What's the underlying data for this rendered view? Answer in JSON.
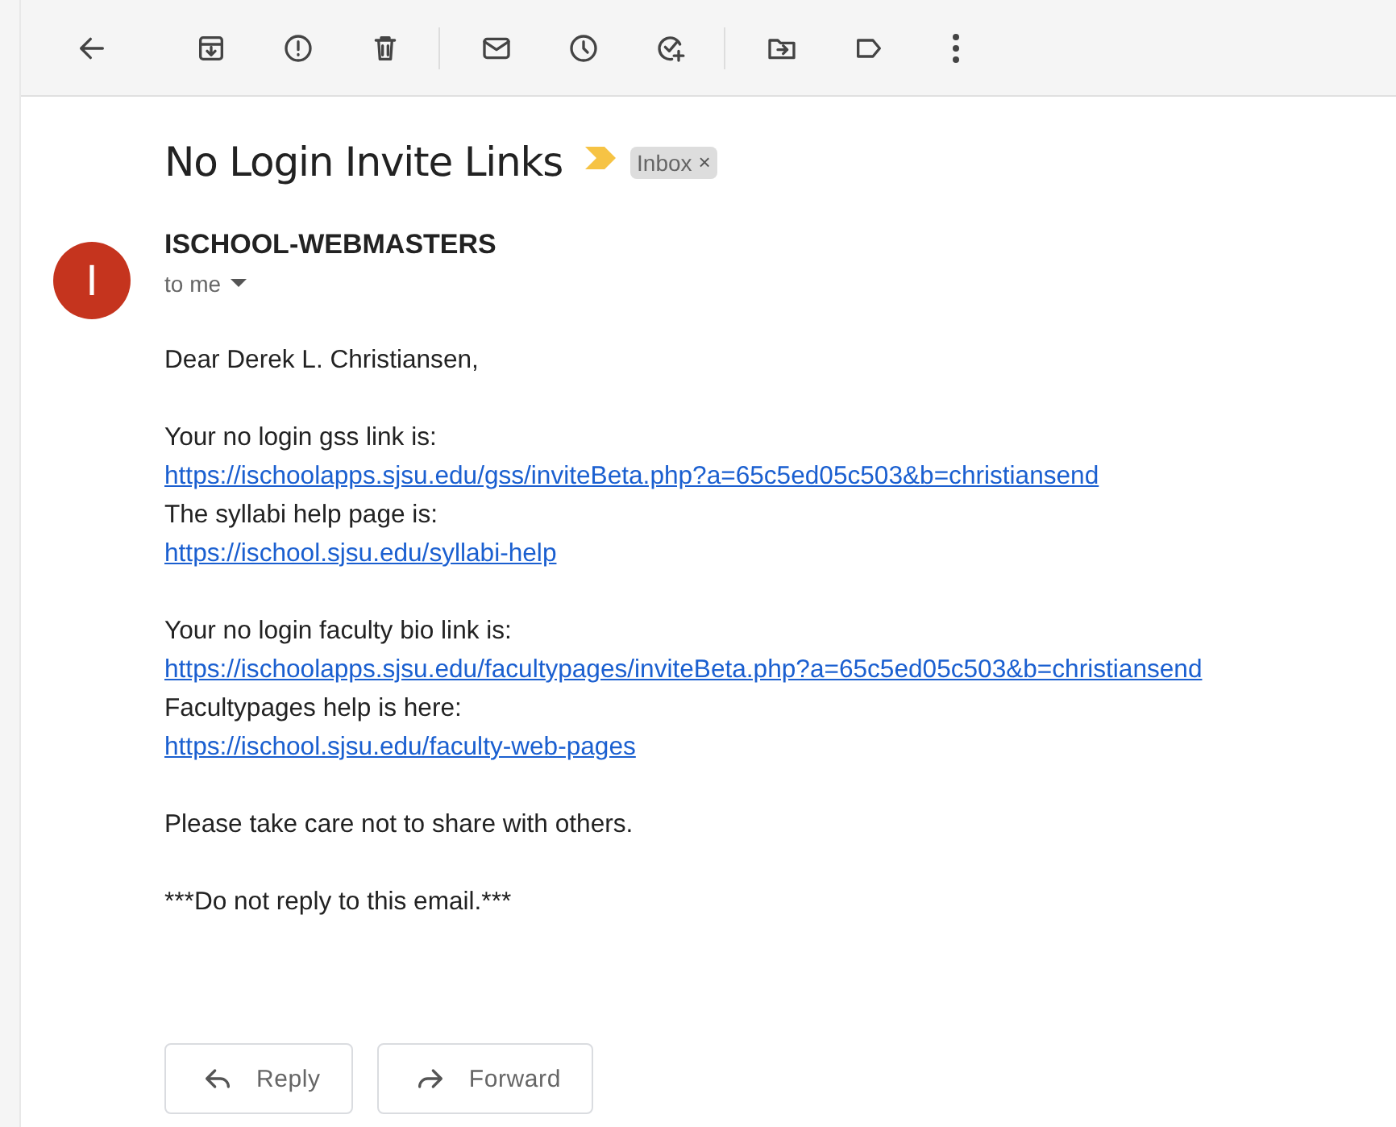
{
  "subject": "No Login Invite Links",
  "important": true,
  "labels": [
    {
      "text": "Inbox",
      "remove": "×"
    }
  ],
  "sender": {
    "initial": "I",
    "name": "ISCHOOL-WEBMASTERS",
    "recipient": "to me"
  },
  "body": [
    [
      {
        "kind": "text",
        "text": "Dear Derek L. Christiansen,"
      }
    ],
    [
      {
        "kind": "text",
        "text": "Your no login gss link is:"
      },
      {
        "kind": "link",
        "text": "https://ischoolapps.sjsu.edu/gss/inviteBeta.php?a=65c5ed05c503&b=christiansend"
      },
      {
        "kind": "text",
        "text": "The syllabi help page is:"
      },
      {
        "kind": "link",
        "text": "https://ischool.sjsu.edu/syllabi-help"
      }
    ],
    [
      {
        "kind": "text",
        "text": "Your no login faculty bio link is:"
      },
      {
        "kind": "link",
        "text": "https://ischoolapps.sjsu.edu/facultypages/inviteBeta.php?a=65c5ed05c503&b=christiansend"
      },
      {
        "kind": "text",
        "text": "Facultypages help is here:"
      },
      {
        "kind": "link",
        "text": "https://ischool.sjsu.edu/faculty-web-pages"
      }
    ],
    [
      {
        "kind": "text",
        "text": "Please take care not to share with others."
      }
    ],
    [
      {
        "kind": "text",
        "text": "***Do not reply to this email.***"
      }
    ]
  ],
  "actions": [
    {
      "kind": "reply",
      "label": "Reply"
    },
    {
      "kind": "forward",
      "label": "Forward"
    }
  ]
}
